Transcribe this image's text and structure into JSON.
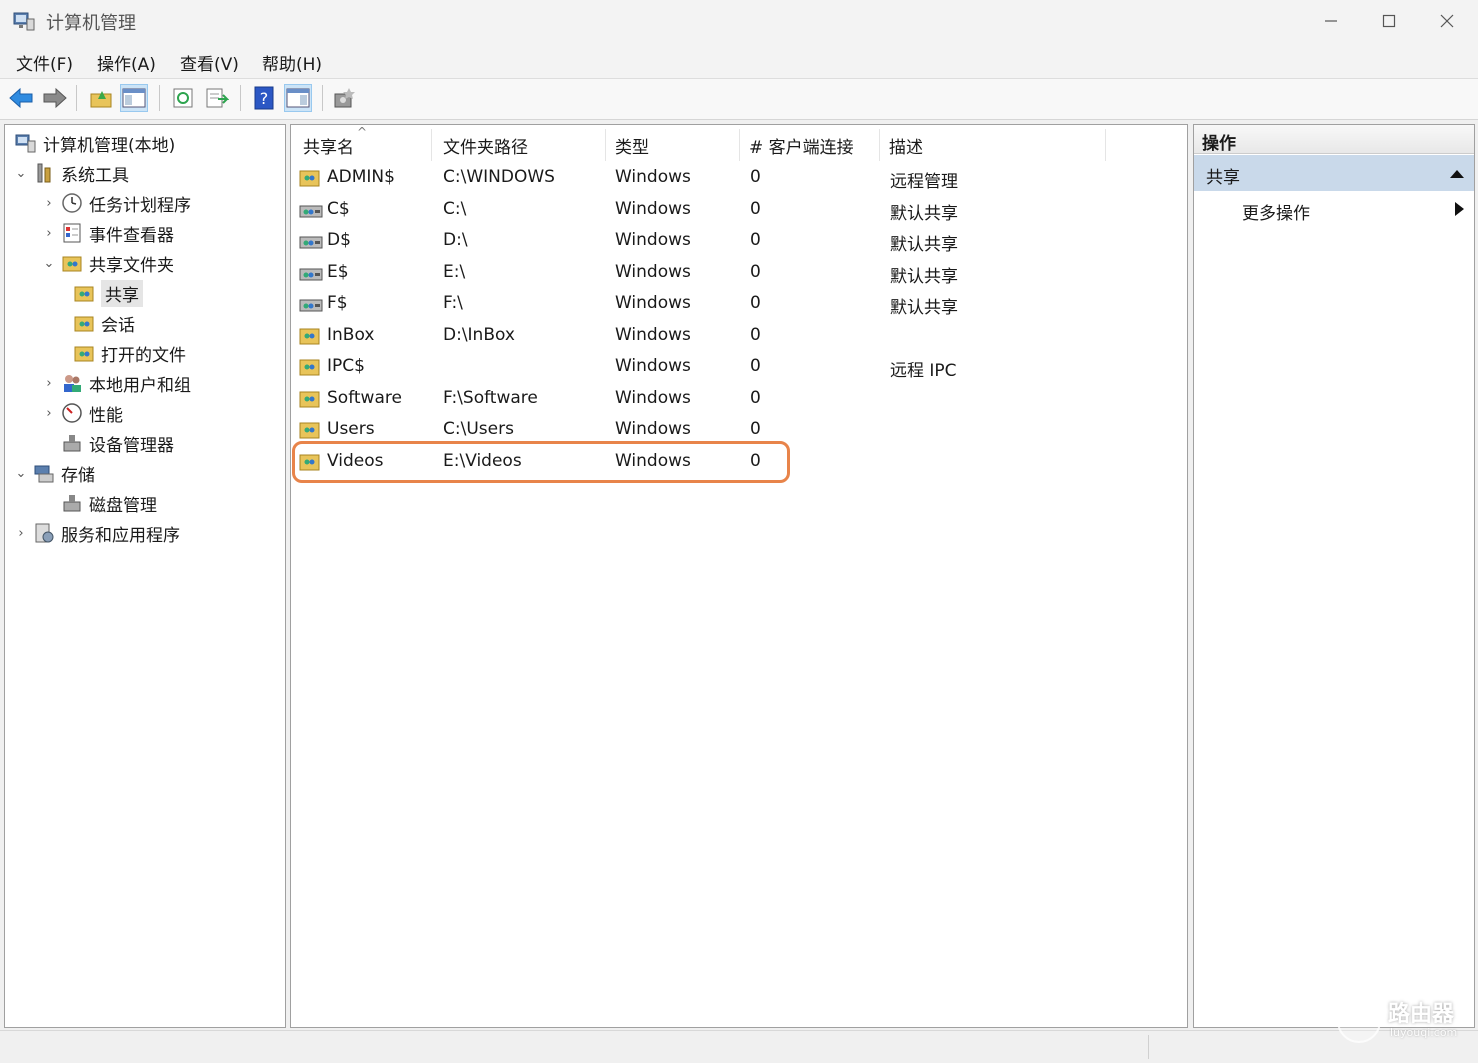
{
  "window": {
    "title": "计算机管理"
  },
  "menu": [
    "文件(F)",
    "操作(A)",
    "查看(V)",
    "帮助(H)"
  ],
  "toolbar": {
    "buttons": [
      "back-icon",
      "forward-icon",
      "up-folder-icon",
      "show-hide-tree-icon",
      "refresh-icon",
      "export-list-icon",
      "help-icon",
      "show-hide-action-pane-icon",
      "new-share-icon"
    ]
  },
  "tree": {
    "root": "计算机管理(本地)",
    "items": [
      {
        "label": "系统工具"
      },
      {
        "label": "任务计划程序"
      },
      {
        "label": "事件查看器"
      },
      {
        "label": "共享文件夹"
      },
      {
        "label": "共享"
      },
      {
        "label": "会话"
      },
      {
        "label": "打开的文件"
      },
      {
        "label": "本地用户和组"
      },
      {
        "label": "性能"
      },
      {
        "label": "设备管理器"
      },
      {
        "label": "存储"
      },
      {
        "label": "磁盘管理"
      },
      {
        "label": "服务和应用程序"
      }
    ]
  },
  "table": {
    "columns": [
      "共享名",
      "文件夹路径",
      "类型",
      "# 客户端连接",
      "描述"
    ],
    "rows": [
      {
        "name": "ADMIN$",
        "path": "C:\\WINDOWS",
        "type": "Windows",
        "clients": "0",
        "desc": "远程管理"
      },
      {
        "name": "C$",
        "path": "C:\\",
        "type": "Windows",
        "clients": "0",
        "desc": "默认共享"
      },
      {
        "name": "D$",
        "path": "D:\\",
        "type": "Windows",
        "clients": "0",
        "desc": "默认共享"
      },
      {
        "name": "E$",
        "path": "E:\\",
        "type": "Windows",
        "clients": "0",
        "desc": "默认共享"
      },
      {
        "name": "F$",
        "path": "F:\\",
        "type": "Windows",
        "clients": "0",
        "desc": "默认共享"
      },
      {
        "name": "InBox",
        "path": "D:\\InBox",
        "type": "Windows",
        "clients": "0",
        "desc": ""
      },
      {
        "name": "IPC$",
        "path": "",
        "type": "Windows",
        "clients": "0",
        "desc": "远程 IPC"
      },
      {
        "name": "Software",
        "path": "F:\\Software",
        "type": "Windows",
        "clients": "0",
        "desc": ""
      },
      {
        "name": "Users",
        "path": "C:\\Users",
        "type": "Windows",
        "clients": "0",
        "desc": ""
      },
      {
        "name": "Videos",
        "path": "E:\\Videos",
        "type": "Windows",
        "clients": "0",
        "desc": ""
      }
    ]
  },
  "actions": {
    "title": "操作",
    "group": "共享",
    "item": "更多操作"
  },
  "watermark": {
    "text": "路由器",
    "sub": "luyouqi.com"
  },
  "colors": {
    "highlight": "#e8844a",
    "action_group_bg": "#c9d9ea"
  }
}
